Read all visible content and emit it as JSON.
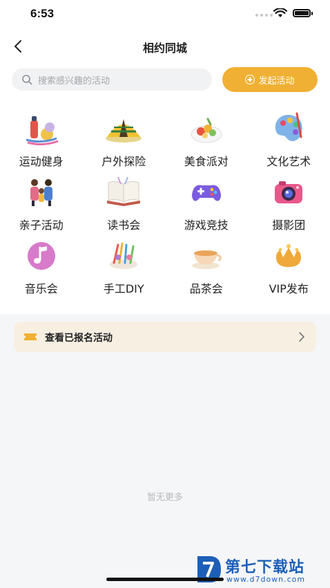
{
  "status": {
    "time": "6:53"
  },
  "nav": {
    "title": "相约同城"
  },
  "search": {
    "placeholder": "搜索感兴趣的活动",
    "launch_label": "发起活动"
  },
  "categories": [
    {
      "label": "运动健身",
      "icon": "sports-fitness-icon"
    },
    {
      "label": "户外探险",
      "icon": "tent-icon"
    },
    {
      "label": "美食派对",
      "icon": "food-plate-icon"
    },
    {
      "label": "文化艺术",
      "icon": "palette-icon"
    },
    {
      "label": "亲子活动",
      "icon": "family-icon"
    },
    {
      "label": "读书会",
      "icon": "open-book-icon"
    },
    {
      "label": "游戏竞技",
      "icon": "gamepad-icon"
    },
    {
      "label": "摄影团",
      "icon": "camera-icon"
    },
    {
      "label": "音乐会",
      "icon": "music-note-icon"
    },
    {
      "label": "手工DIY",
      "icon": "craft-supplies-icon"
    },
    {
      "label": "品茶会",
      "icon": "tea-cup-icon"
    },
    {
      "label": "VIP发布",
      "icon": "vip-crown-icon"
    }
  ],
  "registered": {
    "label": "查看已报名活动"
  },
  "empty": {
    "text": "暂无更多"
  },
  "watermark": {
    "brand": "第七下载站",
    "url": "www.d7down.com"
  },
  "colors": {
    "accent": "#f0b033",
    "card_bg": "#f7efe2",
    "watermark": "#1d5fb8"
  }
}
